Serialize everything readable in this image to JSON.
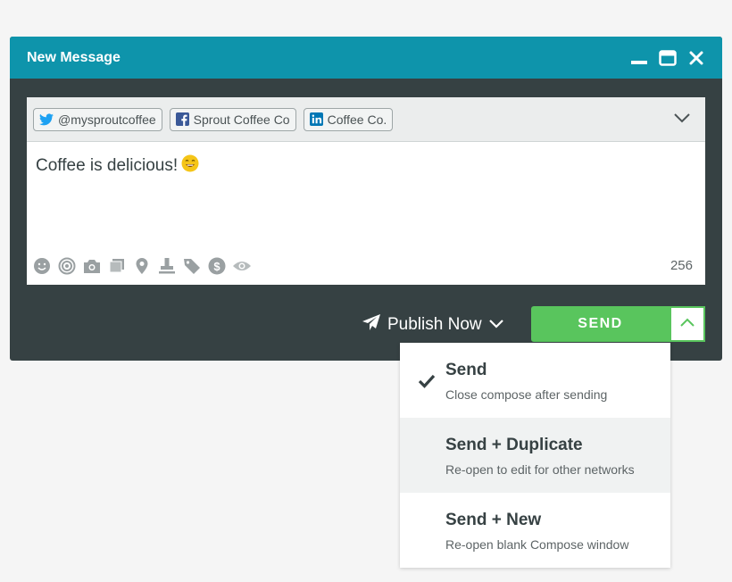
{
  "window": {
    "title": "New Message",
    "controls": [
      "minimize-icon",
      "maximize-icon",
      "close-icon"
    ]
  },
  "profiles": [
    {
      "network": "twitter",
      "icon": "twitter-icon",
      "label": "@mysproutcoffee"
    },
    {
      "network": "facebook",
      "icon": "facebook-icon",
      "label": "Sprout Coffee Co"
    },
    {
      "network": "linkedin",
      "icon": "linkedin-icon",
      "label": "Coffee Co."
    }
  ],
  "compose": {
    "message": "Coffee is delicious!",
    "emoji": "smiling-face",
    "character_count": "256",
    "tools": [
      "emoji-icon",
      "target-icon",
      "camera-icon",
      "gallery-icon",
      "location-icon",
      "stamp-icon",
      "tag-icon",
      "dollar-icon",
      "eye-icon"
    ]
  },
  "footer": {
    "publish_label": "Publish Now",
    "send_label": "SEND"
  },
  "send_menu": [
    {
      "title": "Send",
      "description": "Close compose after sending",
      "checked": true
    },
    {
      "title": "Send + Duplicate",
      "description": "Re-open to edit for other networks",
      "checked": false
    },
    {
      "title": "Send + New",
      "description": "Re-open blank Compose window",
      "checked": false
    }
  ],
  "colors": {
    "header": "#0e94ab",
    "panel": "#364143",
    "send": "#59c55d",
    "twitter": "#1da1f2",
    "facebook": "#3b5998",
    "linkedin": "#0077b5",
    "emoji": "#f5c518"
  }
}
